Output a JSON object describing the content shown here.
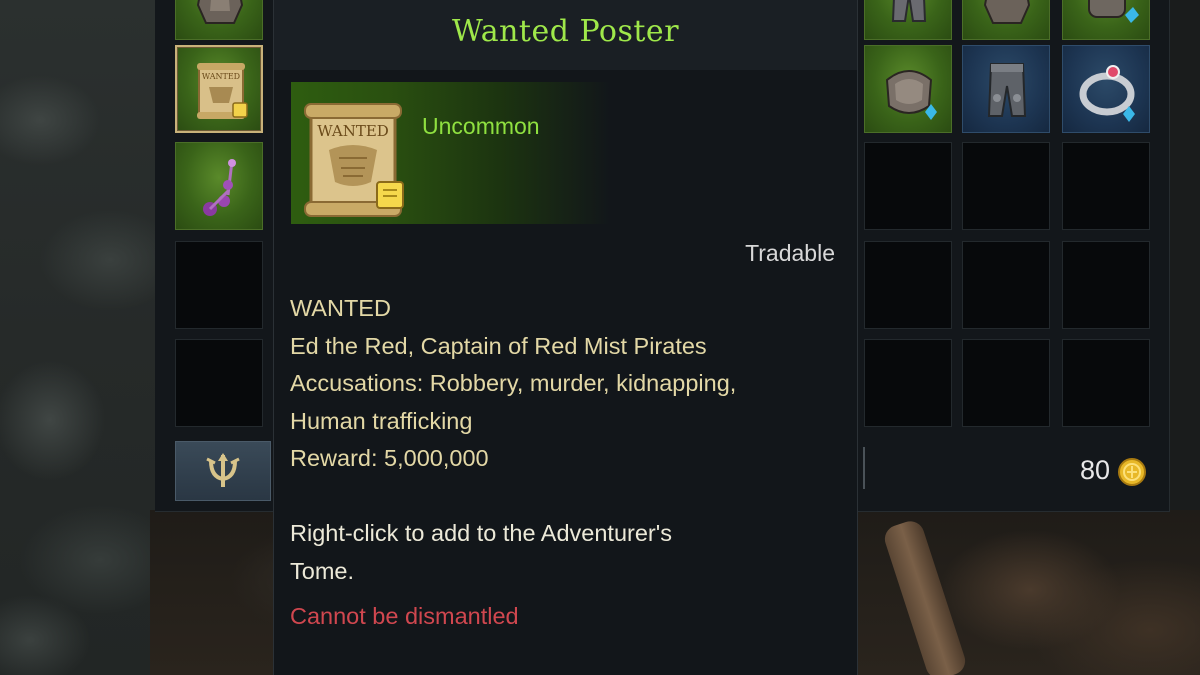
{
  "tooltip": {
    "title": "Wanted Poster",
    "rarity": "Uncommon",
    "tradable": "Tradable",
    "description_lines": [
      "WANTED",
      "Ed the Red, Captain of Red Mist Pirates",
      "Accusations: Robbery, murder, kidnapping,",
      "Human trafficking",
      "Reward: 5,000,000"
    ],
    "usage_lines": [
      "Right-click to add to the Adventurer's",
      "Tome."
    ],
    "warning": "Cannot be dismantled",
    "item_icon": "scroll-icon",
    "poster_text": "WANTED"
  },
  "inventory": {
    "currency": {
      "amount": "80",
      "icon": "gold-coin-icon"
    },
    "action_button_icon": "trident-crest-icon",
    "left_column_items": [
      "armor-chest-icon",
      "wanted-poster-icon",
      "earrings-icon",
      "",
      ""
    ],
    "right_grid_items": [
      [
        "armor-leggings-icon",
        "armor-chest-icon",
        "gauntlet-icon"
      ],
      [
        "gauntlet-icon",
        "leggings-icon",
        "ring-icon"
      ],
      [
        "",
        "",
        ""
      ],
      [
        "",
        "",
        ""
      ],
      [
        "",
        "",
        ""
      ]
    ]
  },
  "colors": {
    "title_green": "#9fe84a",
    "rarity_green": "#8fe040",
    "description_gold": "#e3d8a6",
    "warning_red": "#d0474f",
    "panel_bg": "#12161a"
  }
}
